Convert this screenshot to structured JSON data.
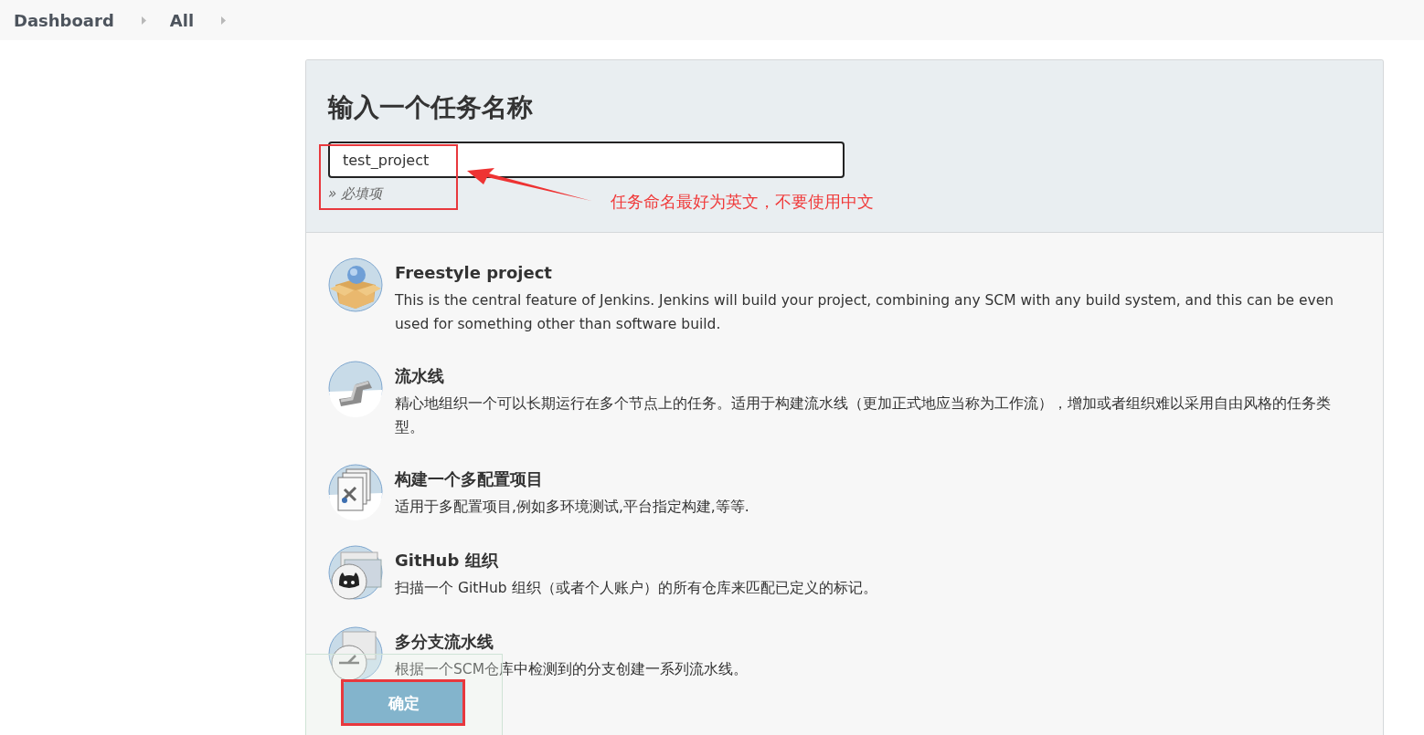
{
  "breadcrumb": [
    {
      "label": "Dashboard"
    },
    {
      "label": "All"
    }
  ],
  "form": {
    "heading": "输入一个任务名称",
    "name_field": {
      "value": "test_project"
    },
    "hint": "» 必填项"
  },
  "annotation": {
    "text": "任务命名最好为英文，不要使用中文"
  },
  "item_types": [
    {
      "kind": "freestyle",
      "title": "Freestyle project",
      "description": "This is the central feature of Jenkins. Jenkins will build your project, combining any SCM with any build system, and this can be even used for something other than software build."
    },
    {
      "kind": "pipeline",
      "title": "流水线",
      "description": "精心地组织一个可以长期运行在多个节点上的任务。适用于构建流水线（更加正式地应当称为工作流），增加或者组织难以采用自由风格的任务类型。"
    },
    {
      "kind": "multiconfig",
      "title": "构建一个多配置项目",
      "description": "适用于多配置项目,例如多环境测试,平台指定构建,等等."
    },
    {
      "kind": "github",
      "title": "GitHub 组织",
      "description": "扫描一个 GitHub 组织（或者个人账户）的所有仓库来匹配已定义的标记。"
    },
    {
      "kind": "multibranch",
      "title": "多分支流水线",
      "description": "根据一个SCM仓库中检测到的分支创建一系列流水线。"
    }
  ],
  "footer": {
    "ok_button": "确定"
  }
}
